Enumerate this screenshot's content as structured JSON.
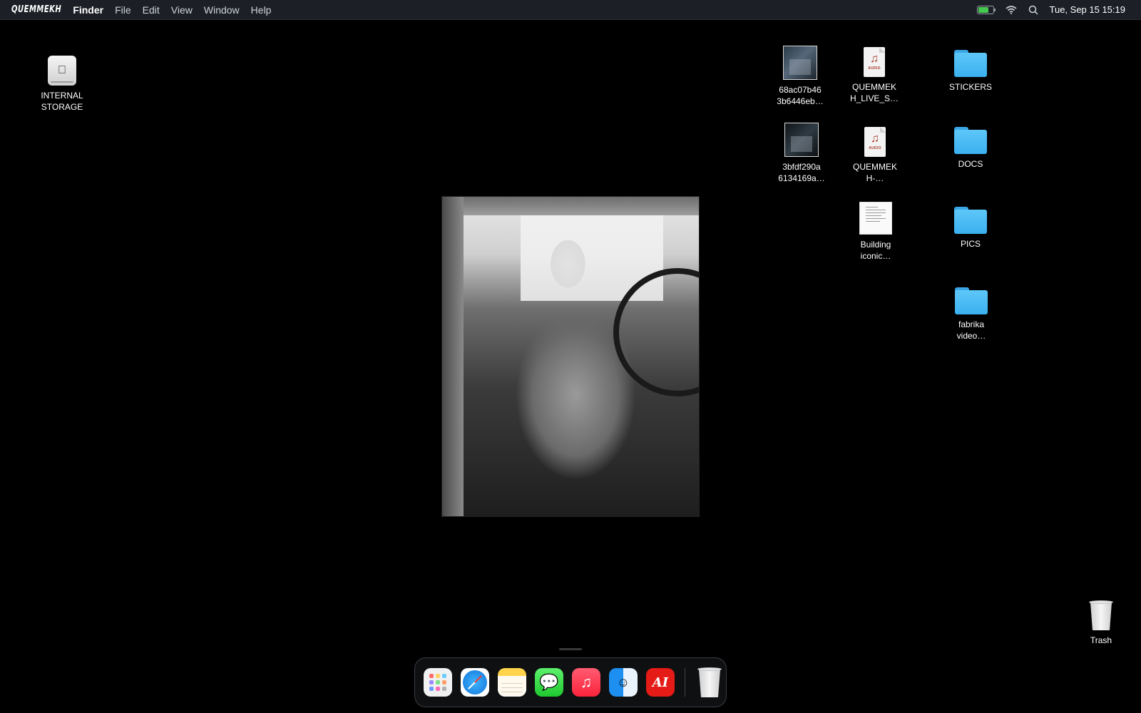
{
  "menubar": {
    "logo": "QUEMMEKH",
    "app_name": "Finder",
    "menus": [
      "File",
      "Edit",
      "View",
      "Window",
      "Help"
    ],
    "clock": "Tue, Sep 15 15:19"
  },
  "desktop": {
    "internal_storage": "INTERNAL\nSTORAGE",
    "files": {
      "video1": "68ac07b46\n3b6446eb…",
      "video2": "3bfdf290a\n6134169a…",
      "audio1": "QUEMMEK\nH_LIVE_S…",
      "audio2": "QUEMMEK\nH-…",
      "doc1": "Building\niconic…"
    },
    "folders": {
      "stickers": "STICKERS",
      "docs": "DOCS",
      "pics": "PICS",
      "fabrika": "fabrika\nvideo…"
    },
    "trash": "Trash",
    "audio_badge": "AUDIO"
  },
  "dock": {
    "apps": [
      "Launchpad",
      "Safari",
      "Notes",
      "Messages",
      "Music",
      "Finder",
      "AI"
    ],
    "ai_label": "AI"
  },
  "colors": {
    "folder": "#4ab9f4",
    "menubar": "#1c1f26",
    "ai_icon": "#e41b17"
  }
}
